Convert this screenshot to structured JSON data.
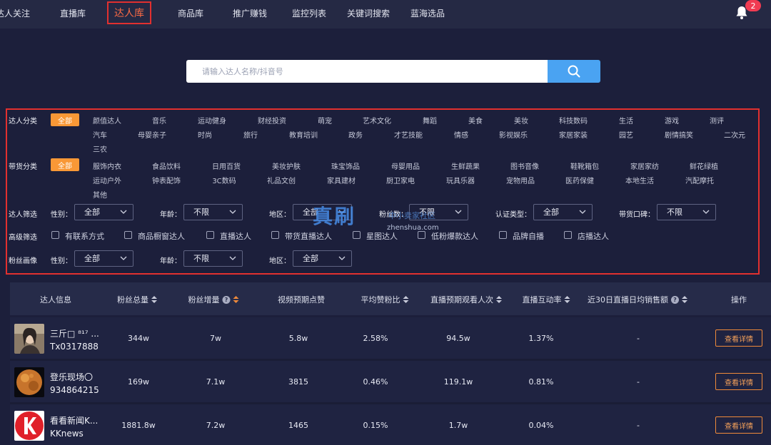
{
  "nav": {
    "items": [
      "达人关注",
      "直播库",
      "达人库",
      "商品库",
      "推广赚钱",
      "监控列表",
      "关键词搜索",
      "蓝海选品"
    ],
    "active_index": 2,
    "notification_count": "2"
  },
  "search": {
    "placeholder": "请输入达人名称/抖音号"
  },
  "filters": {
    "category_label": "达人分类",
    "category_tags": [
      "全部",
      "颜值达人",
      "音乐",
      "运动健身",
      "财经投资",
      "萌宠",
      "艺术文化",
      "舞蹈",
      "美食",
      "美妆",
      "科技数码",
      "生活",
      "游戏",
      "测评",
      "汽车",
      "母婴亲子",
      "时尚",
      "旅行",
      "教育培训",
      "政务",
      "才艺技能",
      "情感",
      "影视娱乐",
      "家居家装",
      "园艺",
      "剧情搞笑",
      "二次元",
      "三农"
    ],
    "goods_label": "带货分类",
    "goods_tags": [
      "全部",
      "服饰内衣",
      "食品饮料",
      "日用百货",
      "美妆护肤",
      "珠宝饰品",
      "母婴用品",
      "生鲜蔬果",
      "图书音像",
      "鞋靴箱包",
      "家居家纺",
      "鲜花绿植",
      "运动户外",
      "钟表配饰",
      "3C数码",
      "礼品文创",
      "家具建材",
      "厨卫家电",
      "玩具乐器",
      "宠物用品",
      "医药保健",
      "本地生活",
      "汽配摩托",
      "其他"
    ],
    "screen_label": "达人筛选",
    "screen_fields": [
      {
        "label": "性别：",
        "value": "全部"
      },
      {
        "label": "年龄：",
        "value": "不限"
      },
      {
        "label": "地区：",
        "value": "全部"
      },
      {
        "label": "粉丝数：",
        "value": "不限"
      },
      {
        "label": "认证类型：",
        "value": "全部"
      },
      {
        "label": "带货口碑：",
        "value": "不限"
      }
    ],
    "advanced_label": "高级筛选",
    "advanced_options": [
      "有联系方式",
      "商品橱窗达人",
      "直播达人",
      "带货直播达人",
      "星图达人",
      "低粉爆款达人",
      "品牌自播",
      "店播达人"
    ],
    "fans_label": "粉丝画像",
    "fans_fields": [
      {
        "label": "性别：",
        "value": "全部"
      },
      {
        "label": "年龄：",
        "value": "不限"
      },
      {
        "label": "地区：",
        "value": "全部"
      }
    ]
  },
  "watermark": {
    "main": "真刷",
    "sub": "中小卖家社区",
    "url": "zhenshua.com"
  },
  "table": {
    "headers": [
      "达人信息",
      "粉丝总量",
      "粉丝增量",
      "视频预期点赞",
      "平均赞粉比",
      "直播预期观看人次",
      "直播互动率",
      "近30日直播日均销售额",
      "操作"
    ],
    "action_label": "查看详情",
    "rows": [
      {
        "name": "三斤□ ⁸¹⁷ ...",
        "id": "Tx0317888",
        "fans": "344w",
        "growth": "7w",
        "likes": "5.8w",
        "ratio": "2.58%",
        "views": "94.5w",
        "interaction": "1.37%",
        "sales": "-",
        "avatar": "portrait"
      },
      {
        "name": "登乐现场〇",
        "id": "934864215",
        "fans": "169w",
        "growth": "7.1w",
        "likes": "3815",
        "ratio": "0.46%",
        "views": "119.1w",
        "interaction": "0.81%",
        "sales": "-",
        "avatar": "planet"
      },
      {
        "name": "看看新闻K...",
        "id": "KKnews",
        "fans": "1881.8w",
        "growth": "7.2w",
        "likes": "1465",
        "ratio": "0.15%",
        "views": "1.7w",
        "interaction": "0.04%",
        "sales": "-",
        "avatar": "news-logo"
      }
    ]
  },
  "colors": {
    "accent": "#f99836",
    "highlight_border": "#e2302f",
    "search_button": "#4aa3f2"
  }
}
